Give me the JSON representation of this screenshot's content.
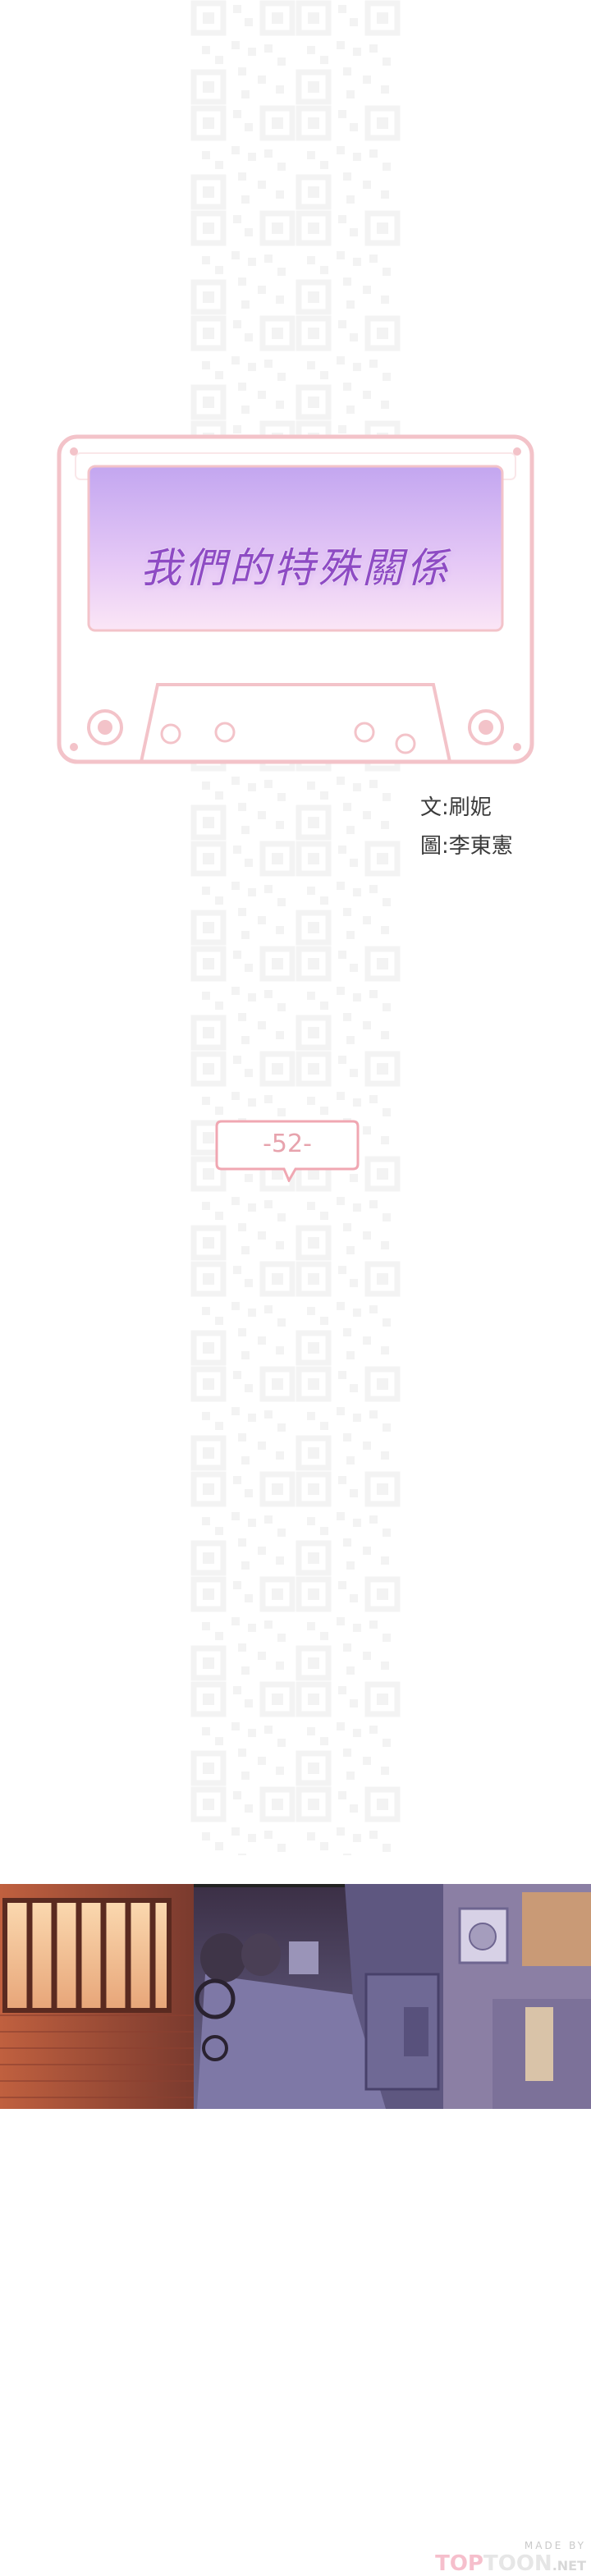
{
  "series_title": "我們的特殊關係",
  "credits": {
    "writer": "文:刷妮",
    "artist": "圖:李東憲"
  },
  "episode_label": "-52-",
  "footer": {
    "made_by": "MADE BY",
    "logo_top": "TOP",
    "logo_toon": "TOON",
    "logo_net": ".NET"
  },
  "colors": {
    "cassette_outline": "#f3c3c9",
    "title_gradient_top": "#c3a6f0",
    "title_gradient_bottom": "#fbe6f6",
    "title_text": "#8e4bc4",
    "episode_outline": "#f0a7b2",
    "brick_wall": "#a64a36",
    "window_glow": "#f6c59b",
    "alley_floor": "#7e78a6"
  }
}
